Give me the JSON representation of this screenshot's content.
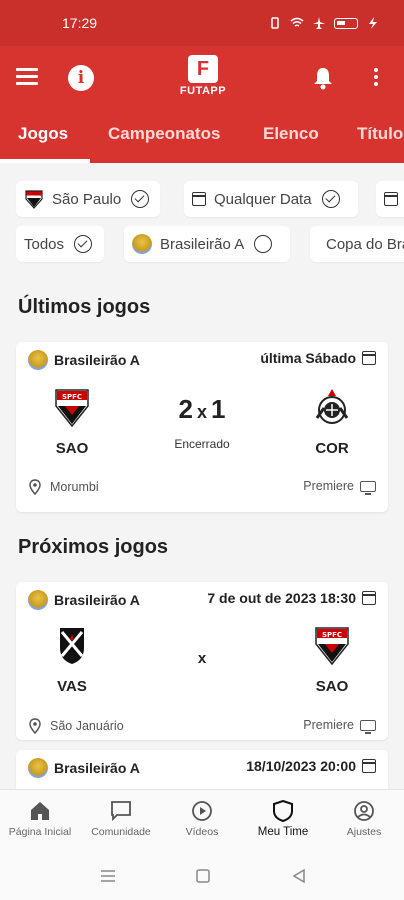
{
  "status_bar": {
    "time": "17:29"
  },
  "app": {
    "logo_text": "FUTAPP",
    "brand_color": "#d8342f"
  },
  "tabs": [
    "Jogos",
    "Campeonatos",
    "Elenco",
    "Títulos"
  ],
  "filters": {
    "team": "São Paulo",
    "date": "Qualquer Data",
    "status": "Todos",
    "competition": "Brasileirão A",
    "cup": "Copa do Brasil"
  },
  "sections": {
    "last": "Últimos jogos",
    "next": "Próximos jogos"
  },
  "last_game": {
    "competition": "Brasileirão A",
    "when": "última Sábado",
    "home": "SAO",
    "away": "COR",
    "home_score": "2",
    "separator": "x",
    "away_score": "1",
    "status": "Encerrado",
    "venue": "Morumbi",
    "broadcast": "Premiere"
  },
  "next_games": [
    {
      "competition": "Brasileirão A",
      "when": "7 de out de 2023 18:30",
      "home": "VAS",
      "vs": "x",
      "away": "SAO",
      "venue": "São Januário",
      "broadcast": "Premiere"
    },
    {
      "competition": "Brasileirão A",
      "when": "18/10/2023 20:00"
    }
  ],
  "bottom_nav": [
    "Página Inicial",
    "Comunidade",
    "Vídeos",
    "Meu Time",
    "Ajustes"
  ]
}
